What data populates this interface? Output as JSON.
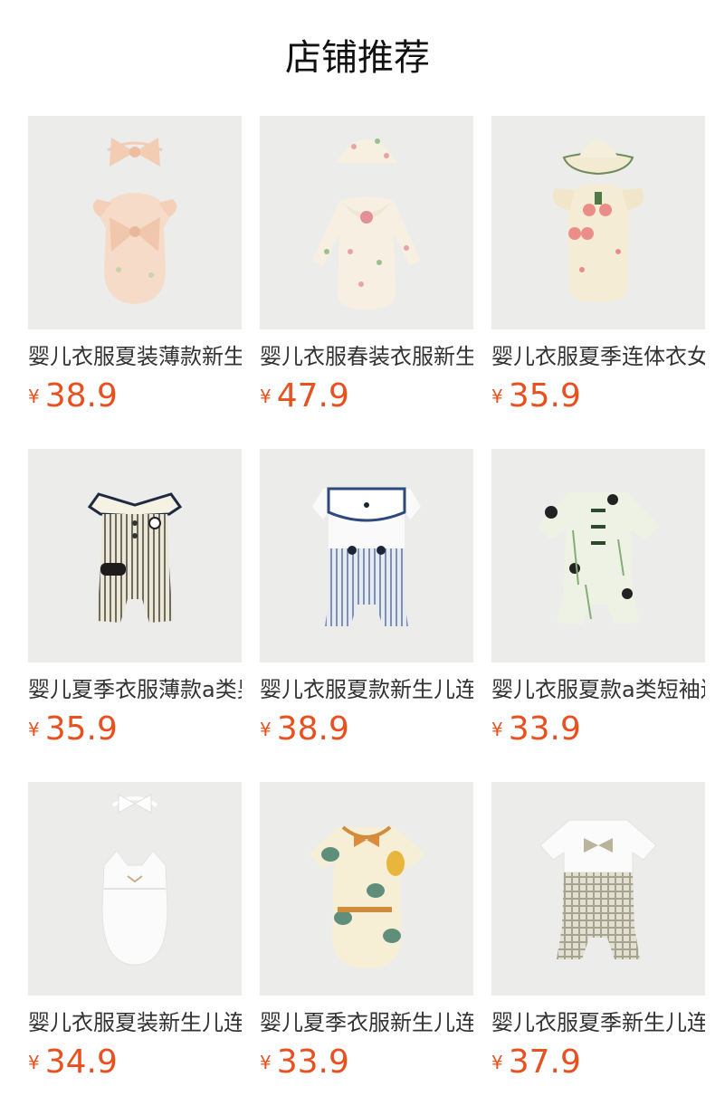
{
  "page": {
    "title": "店铺推荐"
  },
  "colors": {
    "price": "#e8501e",
    "image_bg": "#ececea"
  },
  "products": [
    {
      "name": "婴儿衣服夏装薄款新生儿",
      "currency": "¥",
      "price": "38.9",
      "image": "peach-tulle-bodysuit-with-bow-headband"
    },
    {
      "name": "婴儿衣服春装衣服新生儿",
      "currency": "¥",
      "price": "47.9",
      "image": "floral-long-sleeve-romper-with-bonnet"
    },
    {
      "name": "婴儿衣服夏季连体衣女宝",
      "currency": "¥",
      "price": "35.9",
      "image": "cream-flutter-bodysuit-with-bucket-hat"
    },
    {
      "name": "婴儿夏季衣服薄款a类男宝",
      "currency": "¥",
      "price": "35.9",
      "image": "striped-sailor-collar-romper"
    },
    {
      "name": "婴儿衣服夏款新生儿连体",
      "currency": "¥",
      "price": "38.9",
      "image": "navy-collar-striped-romper"
    },
    {
      "name": "婴儿衣服夏款a类短袖连体",
      "currency": "¥",
      "price": "33.9",
      "image": "panda-bamboo-print-romper"
    },
    {
      "name": "婴儿衣服夏装新生儿连体",
      "currency": "¥",
      "price": "34.9",
      "image": "white-strap-bodysuit-with-headband"
    },
    {
      "name": "婴儿夏季衣服新生儿连体",
      "currency": "¥",
      "price": "33.9",
      "image": "dinosaur-print-short-sleeve-bodysuit"
    },
    {
      "name": "婴儿衣服夏季新生儿连体",
      "currency": "¥",
      "price": "37.9",
      "image": "bowtie-gentleman-check-romper"
    }
  ]
}
